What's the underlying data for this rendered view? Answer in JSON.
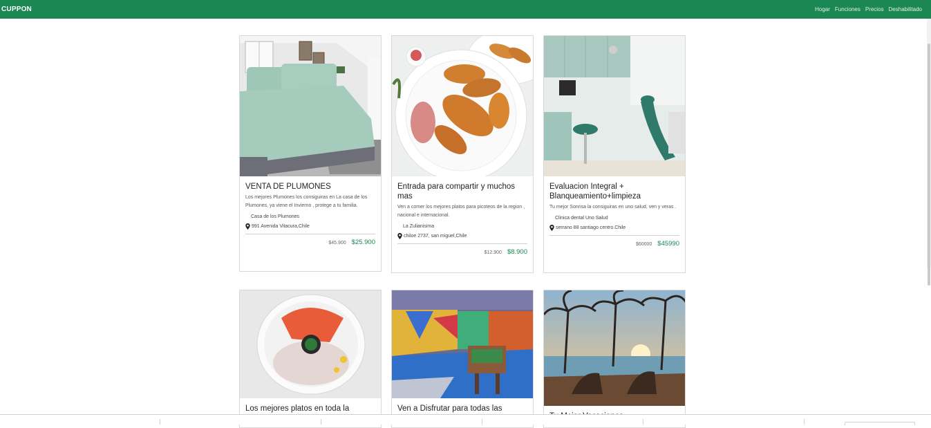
{
  "brand": "CUPPON",
  "nav": {
    "links": [
      "Hogar",
      "Funciones",
      "Precios",
      "Deshabilitado"
    ]
  },
  "cards": [
    {
      "title": "VENTA DE PLUMONES",
      "desc": "Los mejores Plumones los consiguiras en La casa de los Plumones, ya viene el Invierno , protege a tu familia.",
      "vendor": "Casa de los Plumones",
      "location": "991 Avenida Vitacura,Chile",
      "old_price": "$45.900",
      "new_price": "$25.900",
      "image": "bedroom-image"
    },
    {
      "title": "Entrada para compartir y muchos mas",
      "desc": "Ven a comer los mejores platos para picoteos de la region , nacional e internacional.",
      "vendor": "La Zulianisima",
      "location": "chiloe 2737, san miguel,Chile",
      "old_price": "$12.900",
      "new_price": "$8.900",
      "image": "croquettes-image"
    },
    {
      "title": "Evaluacion Integral + Blanqueamiento+limpieza",
      "desc": "Tu mejor Sonrisa la consiguiras en uno salud, ven y veras .",
      "vendor": "Clinica dental Uno Salud",
      "location": "serrano 88 santiago centro.Chile",
      "old_price": "$60000",
      "new_price": "$45990",
      "image": "dental-clinic-image"
    },
    {
      "title": "Los mejores platos en toda la",
      "image": "food-bowl-image"
    },
    {
      "title": "Ven a Disfrutar para todas las",
      "image": "playroom-image"
    },
    {
      "title": "Tu Mejor Vacaciones",
      "image": "beach-image"
    }
  ]
}
